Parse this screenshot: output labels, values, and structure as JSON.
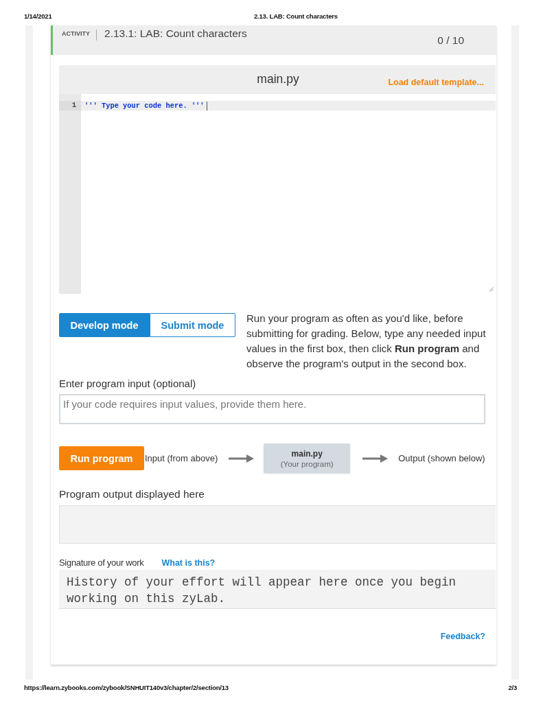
{
  "print_header": {
    "date": "1/14/2021",
    "title": "2.13. LAB: Count characters"
  },
  "activity": {
    "badge": "ACTIVITY",
    "title": "2.13.1: LAB: Count characters",
    "score": "0 / 10"
  },
  "editor": {
    "filename": "main.py",
    "template_link": "Load default template...",
    "lines": [
      {
        "number": "1",
        "code": "''' Type your code here. '''",
        "current": true
      }
    ]
  },
  "modes": [
    {
      "label": "Develop mode",
      "selected": true
    },
    {
      "label": "Submit mode",
      "selected": false
    }
  ],
  "instructions": "Run your program as often as you'd like, before submitting for grading. Below, type any needed input values in the first box, then click **Run program** and observe the program's output in the second box.",
  "input": {
    "label": "Enter program input (optional)",
    "placeholder": "If your code requires input values, provide them here."
  },
  "run": {
    "button": "Run program",
    "input_label": "Input (from above)",
    "program": {
      "name": "main.py",
      "caption": "(Your program)"
    },
    "output_label": "Output (shown below)"
  },
  "output": {
    "label": "Program output displayed here"
  },
  "signature": {
    "label": "Signature of your work",
    "link": "What is this?",
    "text": "History of your effort will appear here once you begin working on this zyLab."
  },
  "feedback": "Feedback?",
  "print_footer": {
    "url": "https://learn.zybooks.com/zybook/SNHUIT140v3/chapter/2/section/13",
    "page": "2/3"
  }
}
